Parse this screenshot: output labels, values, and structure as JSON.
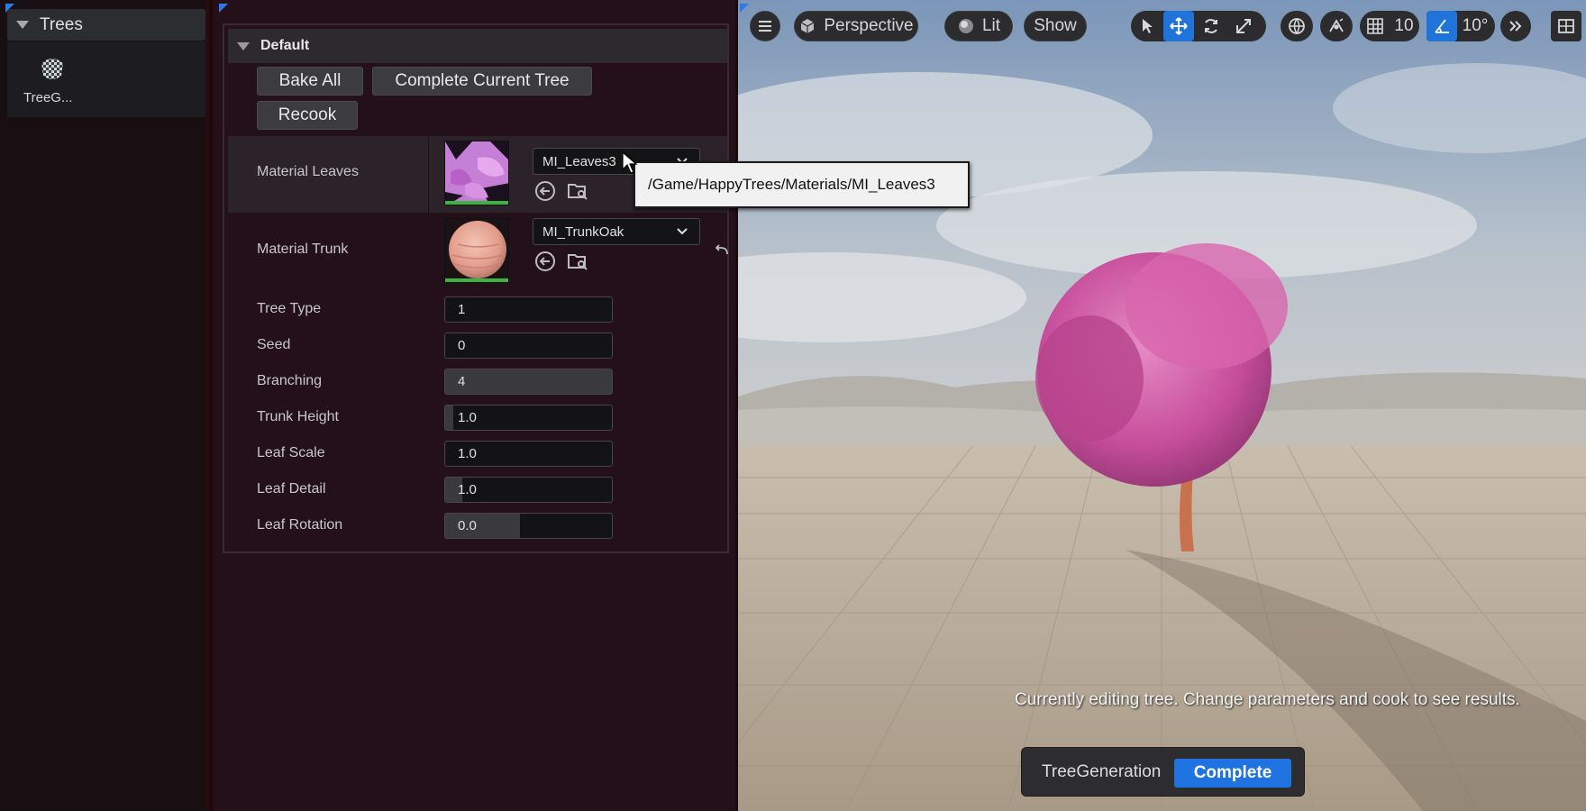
{
  "outliner": {
    "header": "Trees",
    "asset_label": "TreeG..."
  },
  "details": {
    "section_title": "Default",
    "buttons": {
      "bake_all": "Bake All",
      "complete_current_tree": "Complete Current Tree",
      "recook": "Recook"
    },
    "material_leaves": {
      "label": "Material Leaves",
      "value": "MI_Leaves3"
    },
    "material_trunk": {
      "label": "Material Trunk",
      "value": "MI_TrunkOak"
    },
    "properties": [
      {
        "label": "Tree Type",
        "value": "1",
        "fill_fraction": 0
      },
      {
        "label": "Seed",
        "value": "0",
        "fill_fraction": 0
      },
      {
        "label": "Branching",
        "value": "4",
        "fill_fraction": 1.0
      },
      {
        "label": "Trunk Height",
        "value": "1.0",
        "fill_fraction": 0.05
      },
      {
        "label": "Leaf Scale",
        "value": "1.0",
        "fill_fraction": 0
      },
      {
        "label": "Leaf Detail",
        "value": "1.0",
        "fill_fraction": 0.1
      },
      {
        "label": "Leaf Rotation",
        "value": "0.0",
        "fill_fraction": 0.45
      }
    ]
  },
  "tooltip": {
    "text": "/Game/HappyTrees/Materials/MI_Leaves3"
  },
  "viewport": {
    "toolbar": {
      "perspective": "Perspective",
      "lit": "Lit",
      "show": "Show",
      "grid_snap_value": "10",
      "rotation_snap_value": "10°"
    },
    "hint": "Currently editing tree. Change parameters and cook to see results.",
    "progress": {
      "label": "TreeGeneration",
      "status": "Complete"
    }
  },
  "colors": {
    "accent_blue": "#1f73e0",
    "tree_pink": "#d9579f",
    "valid_green": "#3fb342"
  }
}
